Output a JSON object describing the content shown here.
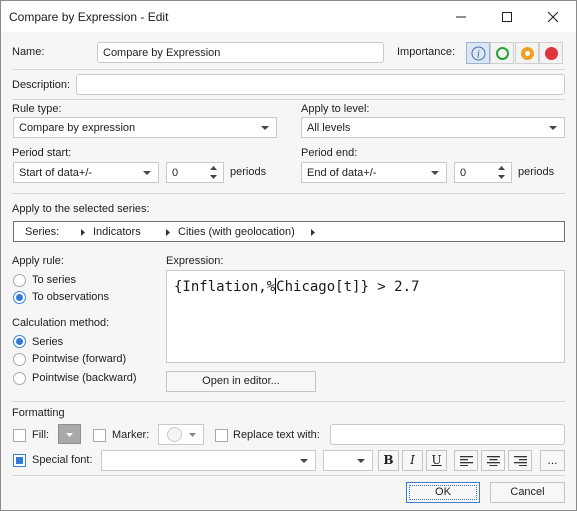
{
  "window": {
    "title": "Compare by Expression - Edit"
  },
  "name": {
    "label": "Name:",
    "value": "Compare by Expression"
  },
  "importance": {
    "label": "Importance:",
    "options": [
      {
        "name": "info",
        "color": "#4a6fa5"
      },
      {
        "name": "low",
        "color": "#27a236"
      },
      {
        "name": "medium",
        "color": "#f0a020"
      },
      {
        "name": "high",
        "color": "#e0353a"
      }
    ]
  },
  "description": {
    "label": "Description:",
    "value": ""
  },
  "rule_type": {
    "label": "Rule type:",
    "value": "Compare by expression"
  },
  "apply_level": {
    "label": "Apply to level:",
    "value": "All levels"
  },
  "period_start": {
    "label": "Period start:",
    "value": "Start of data+/-",
    "offset": "0",
    "unit": "periods"
  },
  "period_end": {
    "label": "Period end:",
    "value": "End of data+/-",
    "offset": "0",
    "unit": "periods"
  },
  "selected_series": {
    "label": "Apply to the selected series:",
    "crumbs": [
      "Series:",
      "Indicators",
      "Cities (with geolocation)"
    ]
  },
  "apply_rule": {
    "label": "Apply rule:",
    "options": [
      "To series",
      "To observations"
    ],
    "selected": "To observations"
  },
  "calc_method": {
    "label": "Calculation method:",
    "options": [
      "Series",
      "Pointwise (forward)",
      "Pointwise (backward)"
    ],
    "selected": "Series"
  },
  "expression": {
    "label": "Expression:",
    "before_caret": "{Inflation,%",
    "after_caret": "Chicago[t]} > 2.7",
    "open_editor": "Open in editor..."
  },
  "formatting": {
    "label": "Formatting",
    "fill_label": "Fill:",
    "marker_label": "Marker:",
    "replace_label": "Replace text with:",
    "replace_value": "",
    "special_font_label": "Special font:",
    "special_font_checked": true,
    "fill_checked": false,
    "marker_checked": false,
    "replace_checked": false,
    "font_name": "",
    "font_size": "",
    "bold": "B",
    "italic": "I",
    "underline": "U",
    "more": "..."
  },
  "buttons": {
    "ok": "OK",
    "cancel": "Cancel"
  }
}
